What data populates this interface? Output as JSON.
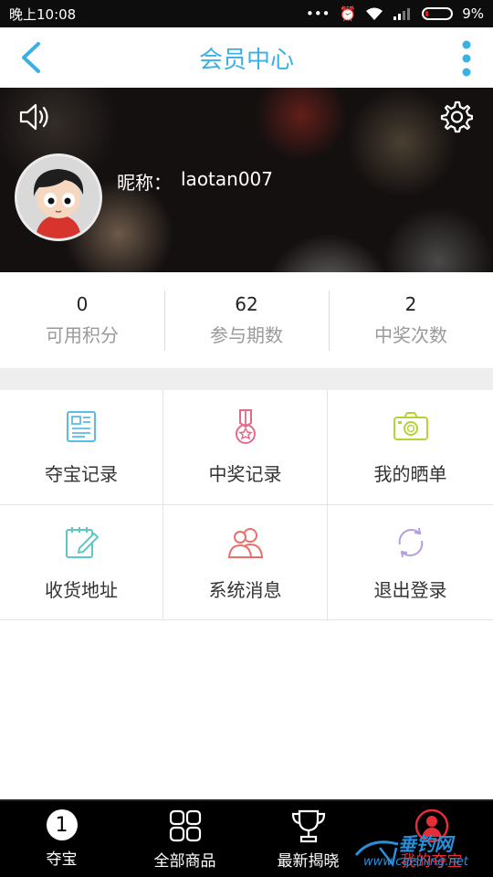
{
  "status_bar": {
    "time": "晚上10:08",
    "battery": "9%"
  },
  "header": {
    "title": "会员中心"
  },
  "profile": {
    "nickname_label": "昵称：",
    "nickname": "laotan007"
  },
  "stats": [
    {
      "value": "0",
      "label": "可用积分"
    },
    {
      "value": "62",
      "label": "参与期数"
    },
    {
      "value": "2",
      "label": "中奖次数"
    }
  ],
  "menu": [
    {
      "label": "夺宝记录",
      "icon": "document-icon",
      "color": "#5bbbe8"
    },
    {
      "label": "中奖记录",
      "icon": "medal-icon",
      "color": "#e46a8a"
    },
    {
      "label": "我的晒单",
      "icon": "camera-icon",
      "color": "#b6d335"
    },
    {
      "label": "收货地址",
      "icon": "notepad-pen-icon",
      "color": "#5cc9c8"
    },
    {
      "label": "系统消息",
      "icon": "users-icon",
      "color": "#ea6f6a"
    },
    {
      "label": "退出登录",
      "icon": "refresh-icon",
      "color": "#b59de0"
    }
  ],
  "bottom_nav": [
    {
      "label": "夺宝",
      "icon": "number-one-icon",
      "badge": "1"
    },
    {
      "label": "全部商品",
      "icon": "grid-icon"
    },
    {
      "label": "最新揭晓",
      "icon": "trophy-icon"
    },
    {
      "label": "我的夺宝",
      "icon": "user-circle-icon",
      "active": true
    }
  ],
  "watermark": {
    "text": "垂钓网",
    "url": "www.cqishing.net"
  }
}
